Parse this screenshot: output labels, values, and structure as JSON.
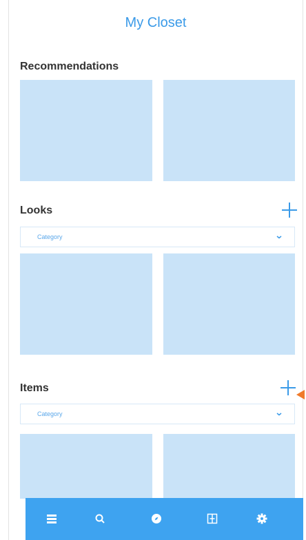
{
  "app": {
    "title": "My Closet"
  },
  "recommendations": {
    "title": "Recommendations"
  },
  "looks": {
    "title": "Looks",
    "category_placeholder": "Category"
  },
  "items": {
    "title": "Items",
    "category_placeholder": "Category"
  },
  "bottom_nav": {
    "tabs": [
      {
        "name": "closet",
        "icon": "list-icon"
      },
      {
        "name": "search",
        "icon": "search-icon"
      },
      {
        "name": "explore",
        "icon": "compass-icon"
      },
      {
        "name": "outfits",
        "icon": "grid-icon"
      },
      {
        "name": "settings",
        "icon": "gear-icon"
      }
    ]
  },
  "colors": {
    "accent": "#3a9ae8",
    "tile": "#c9e3f8",
    "bottom_bar": "#3ea3f0",
    "pointer": "#f07a2a"
  }
}
